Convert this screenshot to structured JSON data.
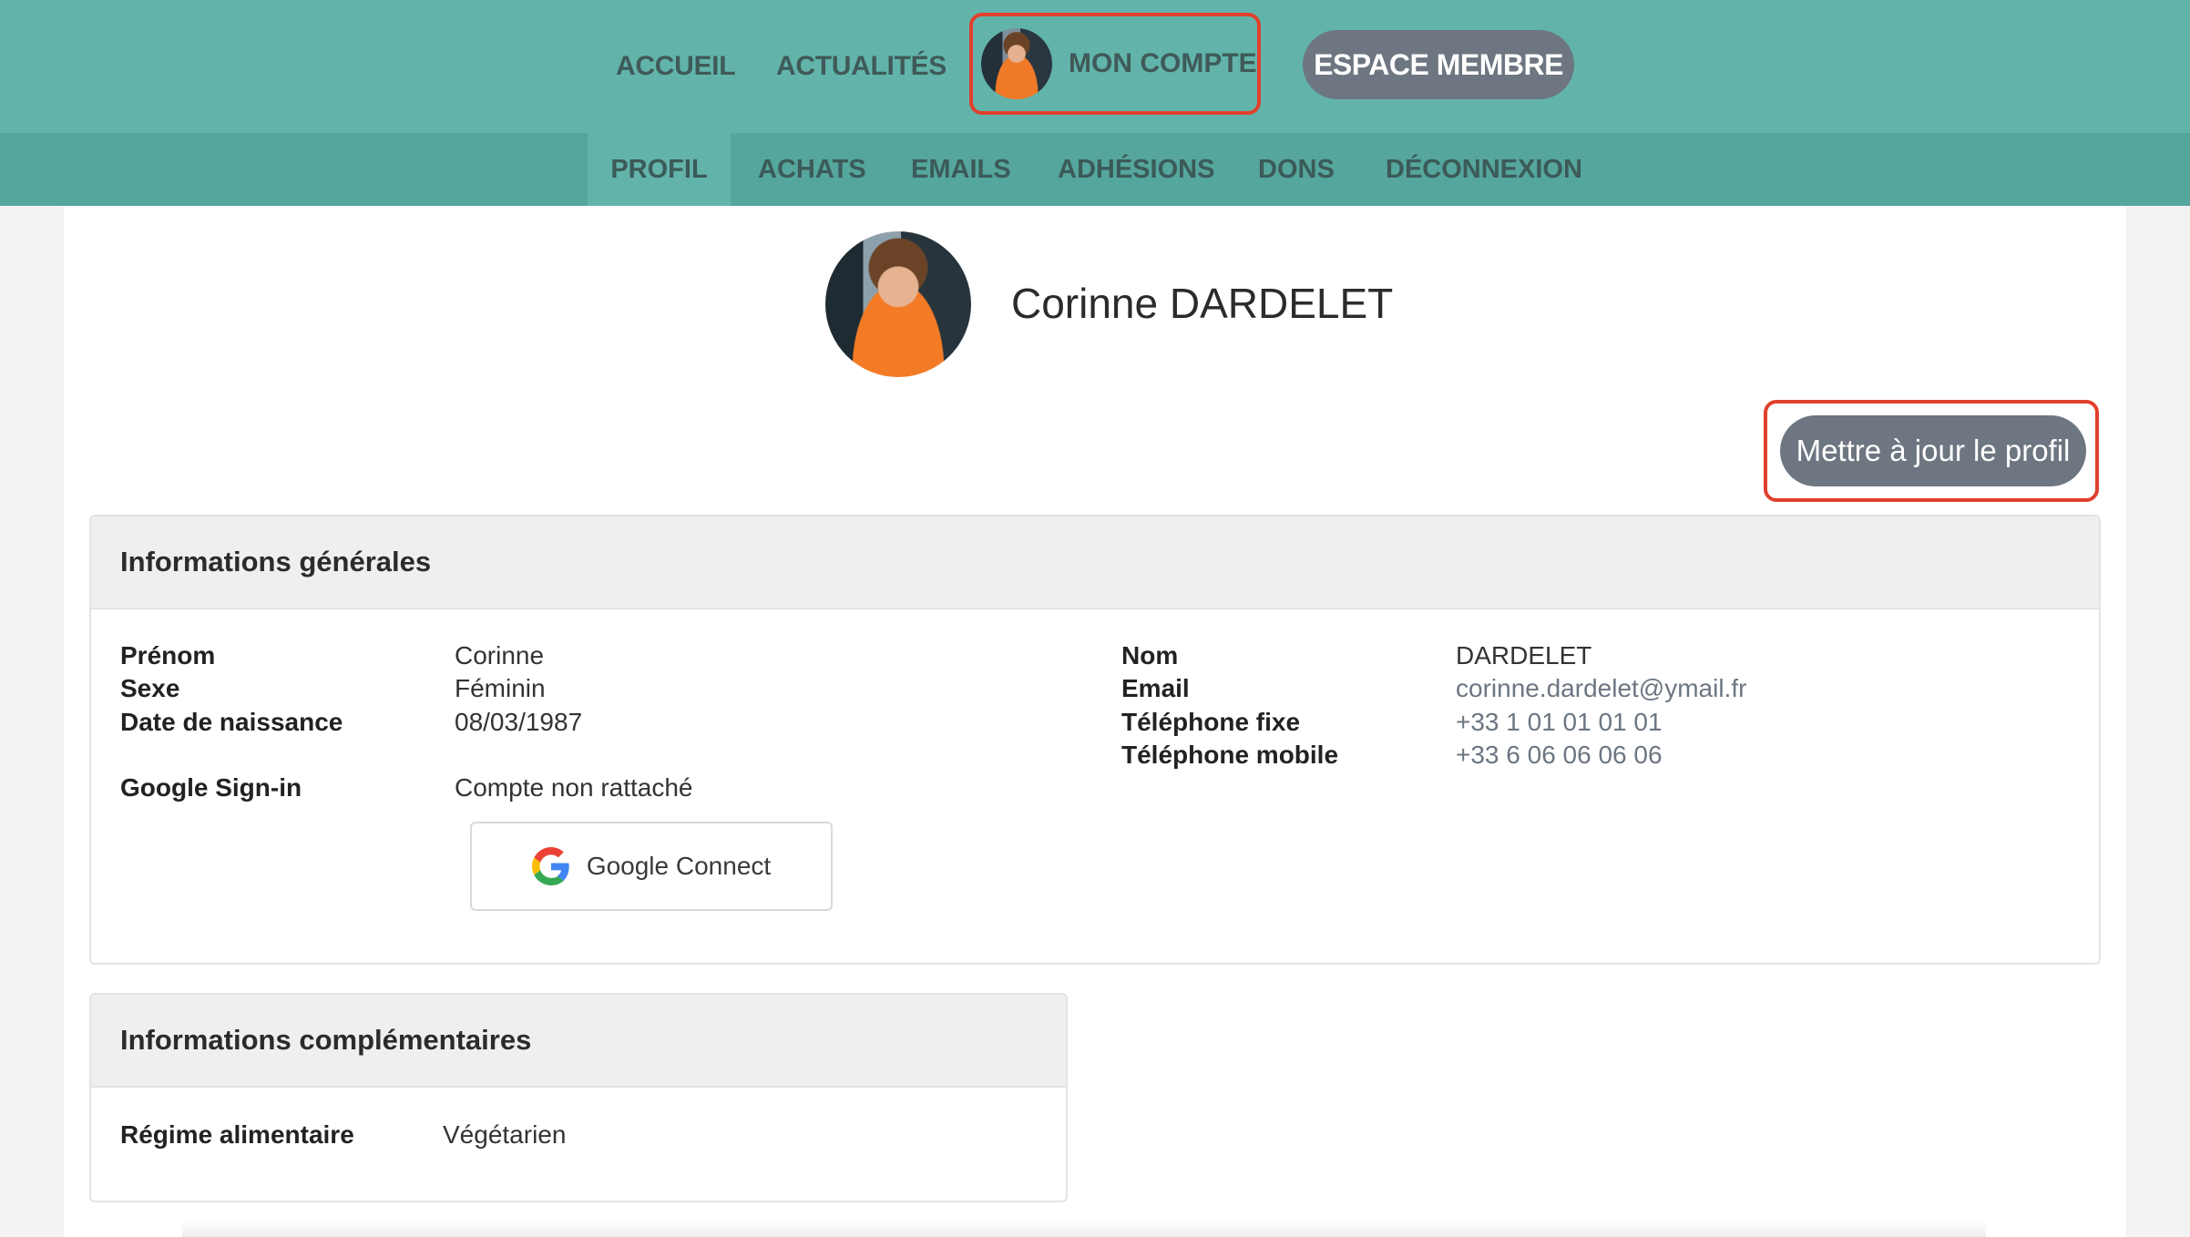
{
  "topnav": {
    "accueil": "ACCUEIL",
    "actualites": "ACTUALITÉS",
    "mon_compte": "MON COMPTE",
    "espace_membre": "ESPACE MEMBRE"
  },
  "subnav": {
    "profil": "PROFIL",
    "achats": "ACHATS",
    "emails": "EMAILS",
    "adhesions": "ADHÉSIONS",
    "dons": "DONS",
    "deconnexion": "DÉCONNEXION"
  },
  "profile": {
    "name": "Corinne DARDELET",
    "update_button": "Mettre à jour le profil"
  },
  "general": {
    "title": "Informations générales",
    "prenom_label": "Prénom",
    "prenom_value": "Corinne",
    "sexe_label": "Sexe",
    "sexe_value": "Féminin",
    "naissance_label": "Date de naissance",
    "naissance_value": "08/03/1987",
    "google_label": "Google Sign-in",
    "google_value": "Compte non rattaché",
    "google_button": "Google Connect",
    "nom_label": "Nom",
    "nom_value": "DARDELET",
    "email_label": "Email",
    "email_value": "corinne.dardelet@ymail.fr",
    "tel_fixe_label": "Téléphone fixe",
    "tel_fixe_value": "+33 1 01 01 01 01",
    "tel_mobile_label": "Téléphone mobile",
    "tel_mobile_value": "+33 6 06 06 06 06"
  },
  "complementary": {
    "title": "Informations complémentaires",
    "regime_label": "Régime alimentaire",
    "regime_value": "Végétarien"
  },
  "colors": {
    "header_teal": "#62b4aa",
    "subnav_teal": "#55a69d",
    "button_gray": "#6d7681",
    "highlight_red": "#e0402c"
  },
  "icons": {
    "account_avatar": "user-photo",
    "google": "google-g-icon"
  }
}
